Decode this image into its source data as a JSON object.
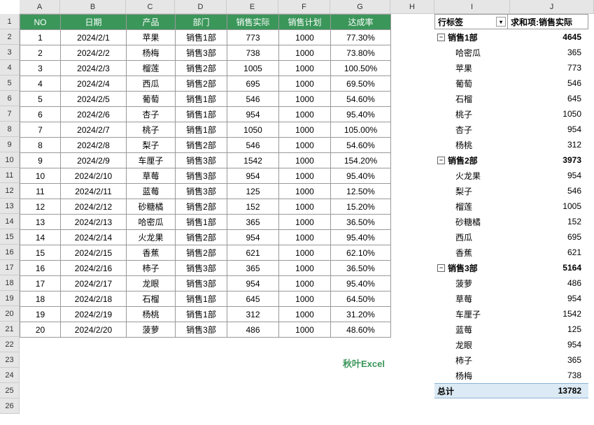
{
  "columns": [
    "A",
    "B",
    "C",
    "D",
    "E",
    "F",
    "G",
    "H",
    "I",
    "J"
  ],
  "col_widths": [
    "cw-A",
    "cw-B",
    "cw-C",
    "cw-D",
    "cw-E",
    "cw-F",
    "cw-G",
    "cw-H",
    "cw-I",
    "cw-J"
  ],
  "row_count": 26,
  "headers": {
    "no": "NO",
    "date": "日期",
    "product": "产品",
    "dept": "部门",
    "actual": "销售实际",
    "plan": "销售计划",
    "rate": "达成率"
  },
  "rows": [
    {
      "no": "1",
      "date": "2024/2/1",
      "product": "苹果",
      "dept": "销售1部",
      "actual": "773",
      "plan": "1000",
      "rate": "77.30%"
    },
    {
      "no": "2",
      "date": "2024/2/2",
      "product": "杨梅",
      "dept": "销售3部",
      "actual": "738",
      "plan": "1000",
      "rate": "73.80%"
    },
    {
      "no": "3",
      "date": "2024/2/3",
      "product": "榴莲",
      "dept": "销售2部",
      "actual": "1005",
      "plan": "1000",
      "rate": "100.50%"
    },
    {
      "no": "4",
      "date": "2024/2/4",
      "product": "西瓜",
      "dept": "销售2部",
      "actual": "695",
      "plan": "1000",
      "rate": "69.50%"
    },
    {
      "no": "5",
      "date": "2024/2/5",
      "product": "葡萄",
      "dept": "销售1部",
      "actual": "546",
      "plan": "1000",
      "rate": "54.60%"
    },
    {
      "no": "6",
      "date": "2024/2/6",
      "product": "杏子",
      "dept": "销售1部",
      "actual": "954",
      "plan": "1000",
      "rate": "95.40%"
    },
    {
      "no": "7",
      "date": "2024/2/7",
      "product": "桃子",
      "dept": "销售1部",
      "actual": "1050",
      "plan": "1000",
      "rate": "105.00%"
    },
    {
      "no": "8",
      "date": "2024/2/8",
      "product": "梨子",
      "dept": "销售2部",
      "actual": "546",
      "plan": "1000",
      "rate": "54.60%"
    },
    {
      "no": "9",
      "date": "2024/2/9",
      "product": "车厘子",
      "dept": "销售3部",
      "actual": "1542",
      "plan": "1000",
      "rate": "154.20%"
    },
    {
      "no": "10",
      "date": "2024/2/10",
      "product": "草莓",
      "dept": "销售3部",
      "actual": "954",
      "plan": "1000",
      "rate": "95.40%"
    },
    {
      "no": "11",
      "date": "2024/2/11",
      "product": "蓝莓",
      "dept": "销售3部",
      "actual": "125",
      "plan": "1000",
      "rate": "12.50%"
    },
    {
      "no": "12",
      "date": "2024/2/12",
      "product": "砂糖橘",
      "dept": "销售2部",
      "actual": "152",
      "plan": "1000",
      "rate": "15.20%"
    },
    {
      "no": "13",
      "date": "2024/2/13",
      "product": "哈密瓜",
      "dept": "销售1部",
      "actual": "365",
      "plan": "1000",
      "rate": "36.50%"
    },
    {
      "no": "14",
      "date": "2024/2/14",
      "product": "火龙果",
      "dept": "销售2部",
      "actual": "954",
      "plan": "1000",
      "rate": "95.40%"
    },
    {
      "no": "15",
      "date": "2024/2/15",
      "product": "香蕉",
      "dept": "销售2部",
      "actual": "621",
      "plan": "1000",
      "rate": "62.10%"
    },
    {
      "no": "16",
      "date": "2024/2/16",
      "product": "柿子",
      "dept": "销售3部",
      "actual": "365",
      "plan": "1000",
      "rate": "36.50%"
    },
    {
      "no": "17",
      "date": "2024/2/17",
      "product": "龙眼",
      "dept": "销售3部",
      "actual": "954",
      "plan": "1000",
      "rate": "95.40%"
    },
    {
      "no": "18",
      "date": "2024/2/18",
      "product": "石榴",
      "dept": "销售1部",
      "actual": "645",
      "plan": "1000",
      "rate": "64.50%"
    },
    {
      "no": "19",
      "date": "2024/2/19",
      "product": "杨桃",
      "dept": "销售1部",
      "actual": "312",
      "plan": "1000",
      "rate": "31.20%"
    },
    {
      "no": "20",
      "date": "2024/2/20",
      "product": "菠萝",
      "dept": "销售3部",
      "actual": "486",
      "plan": "1000",
      "rate": "48.60%"
    }
  ],
  "brand": "秋叶Excel",
  "pivot": {
    "row_label": "行标签",
    "value_label": "求和项:销售实际",
    "groups": [
      {
        "name": "销售1部",
        "total": "4645",
        "items": [
          {
            "name": "哈密瓜",
            "val": "365"
          },
          {
            "name": "苹果",
            "val": "773"
          },
          {
            "name": "葡萄",
            "val": "546"
          },
          {
            "name": "石榴",
            "val": "645"
          },
          {
            "name": "桃子",
            "val": "1050"
          },
          {
            "name": "杏子",
            "val": "954"
          },
          {
            "name": "杨桃",
            "val": "312"
          }
        ]
      },
      {
        "name": "销售2部",
        "total": "3973",
        "items": [
          {
            "name": "火龙果",
            "val": "954"
          },
          {
            "name": "梨子",
            "val": "546"
          },
          {
            "name": "榴莲",
            "val": "1005"
          },
          {
            "name": "砂糖橘",
            "val": "152"
          },
          {
            "name": "西瓜",
            "val": "695"
          },
          {
            "name": "香蕉",
            "val": "621"
          }
        ]
      },
      {
        "name": "销售3部",
        "total": "5164",
        "items": [
          {
            "name": "菠萝",
            "val": "486"
          },
          {
            "name": "草莓",
            "val": "954"
          },
          {
            "name": "车厘子",
            "val": "1542"
          },
          {
            "name": "蓝莓",
            "val": "125"
          },
          {
            "name": "龙眼",
            "val": "954"
          },
          {
            "name": "柿子",
            "val": "365"
          },
          {
            "name": "杨梅",
            "val": "738"
          }
        ]
      }
    ],
    "grand_label": "总计",
    "grand_total": "13782"
  }
}
